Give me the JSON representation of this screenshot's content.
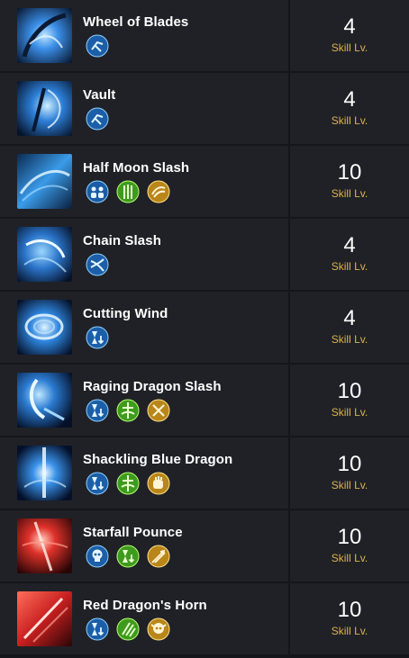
{
  "level_label": "Skill Lv.",
  "skills": [
    {
      "name": "Wheel of Blades",
      "level": "4",
      "tripods": [
        "dash-icon"
      ]
    },
    {
      "name": "Vault",
      "level": "4",
      "tripods": [
        "dash-icon"
      ]
    },
    {
      "name": "Half Moon Slash",
      "level": "10",
      "tripods": [
        "party-icon",
        "green-blade-icon",
        "gold-slash-icon"
      ]
    },
    {
      "name": "Chain Slash",
      "level": "4",
      "tripods": [
        "blue-slash-icon"
      ]
    },
    {
      "name": "Cutting Wind",
      "level": "4",
      "tripods": [
        "hourglass-icon"
      ]
    },
    {
      "name": "Raging Dragon Slash",
      "level": "10",
      "tripods": [
        "hourglass-icon",
        "green-totem-icon",
        "gold-cross-icon"
      ]
    },
    {
      "name": "Shackling Blue Dragon",
      "level": "10",
      "tripods": [
        "hourglass-icon",
        "green-totem-icon",
        "gold-fist-icon"
      ]
    },
    {
      "name": "Starfall Pounce",
      "level": "10",
      "tripods": [
        "skull-icon",
        "green-hourglass-icon",
        "gold-arrows-icon"
      ]
    },
    {
      "name": "Red Dragon's Horn",
      "level": "10",
      "tripods": [
        "hourglass-icon",
        "green-claw-icon",
        "gold-skull-icon"
      ]
    }
  ]
}
